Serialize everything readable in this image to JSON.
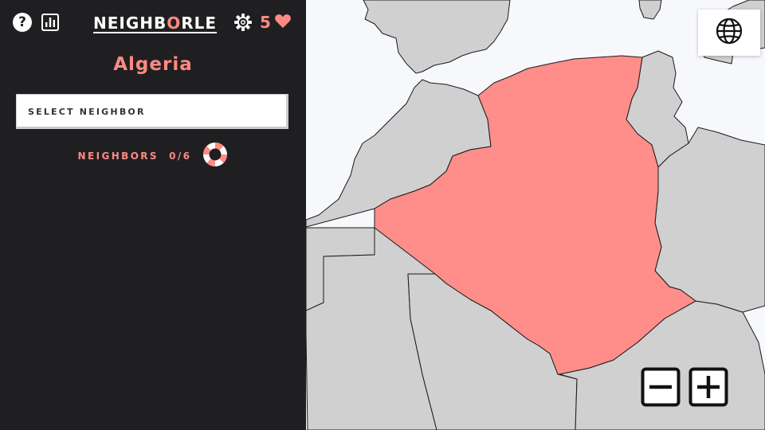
{
  "header": {
    "logo_prefix": "NEIGHB",
    "logo_highlight": "O",
    "logo_suffix": "RLE",
    "lives": "5"
  },
  "game": {
    "country": "Algeria",
    "select_label": "SELECT NEIGHBOR",
    "neighbors_label": "NEIGHBORS",
    "neighbors_progress": "0/6"
  },
  "icons": {
    "help": "help-icon",
    "stats": "stats-icon",
    "settings": "gear-icon",
    "lives": "heart-icon",
    "hint": "lifebuoy-icon",
    "language": "globe-icon",
    "zoom_out": "zoom-out-icon",
    "zoom_in": "zoom-in-icon"
  },
  "colors": {
    "sidebar_bg": "#1f1f21",
    "accent": "#ff8a82",
    "target_country": "#ff8e8a",
    "land": "#d0d0d0",
    "sea": "#f7f8fc",
    "border": "#1a1a1a"
  }
}
